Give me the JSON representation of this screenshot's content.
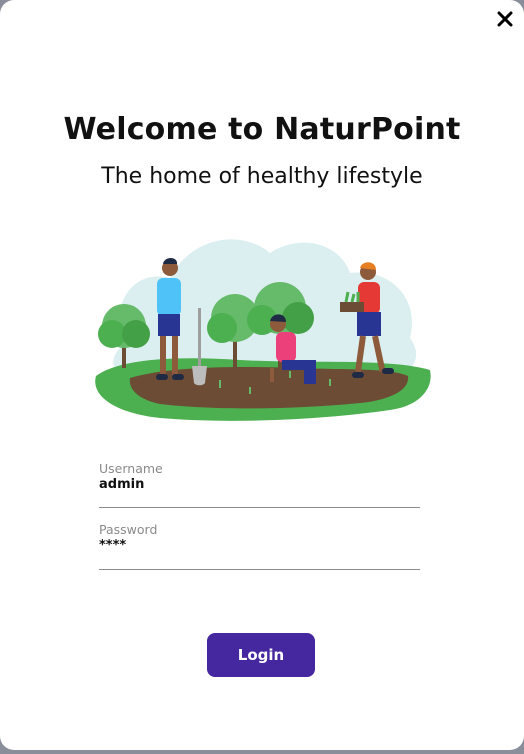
{
  "header": {
    "title": "Welcome to NaturPoint",
    "subtitle": "The home of healthy lifestyle"
  },
  "close": {
    "icon": "close-icon"
  },
  "illustration": {
    "icon": "gardening-people-illustration"
  },
  "form": {
    "username_label": "Username",
    "username_value": "admin",
    "password_label": "Password",
    "password_value": "****"
  },
  "actions": {
    "login_label": "Login"
  },
  "colors": {
    "accent": "#4527a0",
    "background": "#ffffff",
    "text": "#111111",
    "label": "#8a8a8a"
  }
}
